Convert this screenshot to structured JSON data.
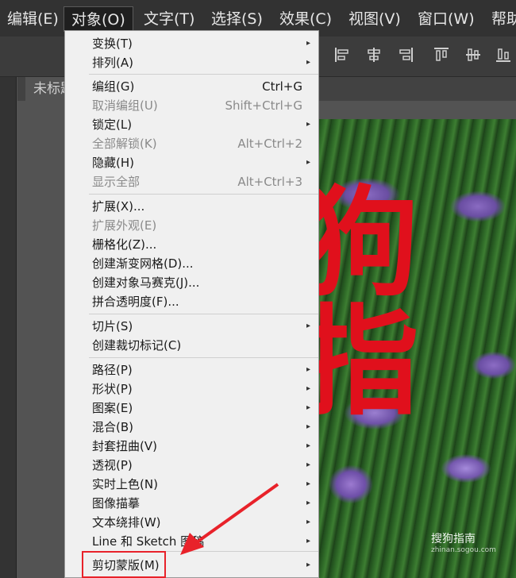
{
  "menubar": {
    "items": [
      {
        "label": "编辑(E)"
      },
      {
        "label": "对象(O)"
      },
      {
        "label": "文字(T)"
      },
      {
        "label": "选择(S)"
      },
      {
        "label": "效果(C)"
      },
      {
        "label": "视图(V)"
      },
      {
        "label": "窗口(W)"
      },
      {
        "label": "帮助"
      }
    ]
  },
  "document_tab": {
    "label": "未标题"
  },
  "artwork_text": "狗指",
  "object_menu": {
    "items": [
      {
        "label": "变换(T)",
        "submenu": true
      },
      {
        "label": "排列(A)",
        "submenu": true
      },
      {
        "label": "编组(G)",
        "shortcut": "Ctrl+G"
      },
      {
        "label": "取消编组(U)",
        "shortcut": "Shift+Ctrl+G",
        "disabled": true
      },
      {
        "label": "锁定(L)",
        "submenu": true
      },
      {
        "label": "全部解锁(K)",
        "shortcut": "Alt+Ctrl+2",
        "disabled": true
      },
      {
        "label": "隐藏(H)",
        "submenu": true
      },
      {
        "label": "显示全部",
        "shortcut": "Alt+Ctrl+3",
        "disabled": true
      },
      {
        "label": "扩展(X)..."
      },
      {
        "label": "扩展外观(E)",
        "disabled": true
      },
      {
        "label": "栅格化(Z)..."
      },
      {
        "label": "创建渐变网格(D)..."
      },
      {
        "label": "创建对象马赛克(J)..."
      },
      {
        "label": "拼合透明度(F)..."
      },
      {
        "label": "切片(S)",
        "submenu": true
      },
      {
        "label": "创建裁切标记(C)"
      },
      {
        "label": "路径(P)",
        "submenu": true
      },
      {
        "label": "形状(P)",
        "submenu": true
      },
      {
        "label": "图案(E)",
        "submenu": true
      },
      {
        "label": "混合(B)",
        "submenu": true
      },
      {
        "label": "封套扭曲(V)",
        "submenu": true
      },
      {
        "label": "透视(P)",
        "submenu": true
      },
      {
        "label": "实时上色(N)",
        "submenu": true
      },
      {
        "label": "图像描摹",
        "submenu": true
      },
      {
        "label": "文本绕排(W)",
        "submenu": true
      },
      {
        "label": "Line 和 Sketch 图稿",
        "submenu": true
      },
      {
        "label": "剪切蒙版(M)",
        "submenu": true
      }
    ]
  },
  "watermark": {
    "title": "搜狗指南",
    "url": "zhinan.sogou.com"
  },
  "colors": {
    "highlight": "#e8222a",
    "menu_bg": "#f0f0f0",
    "artwork_text": "#e0101c"
  }
}
